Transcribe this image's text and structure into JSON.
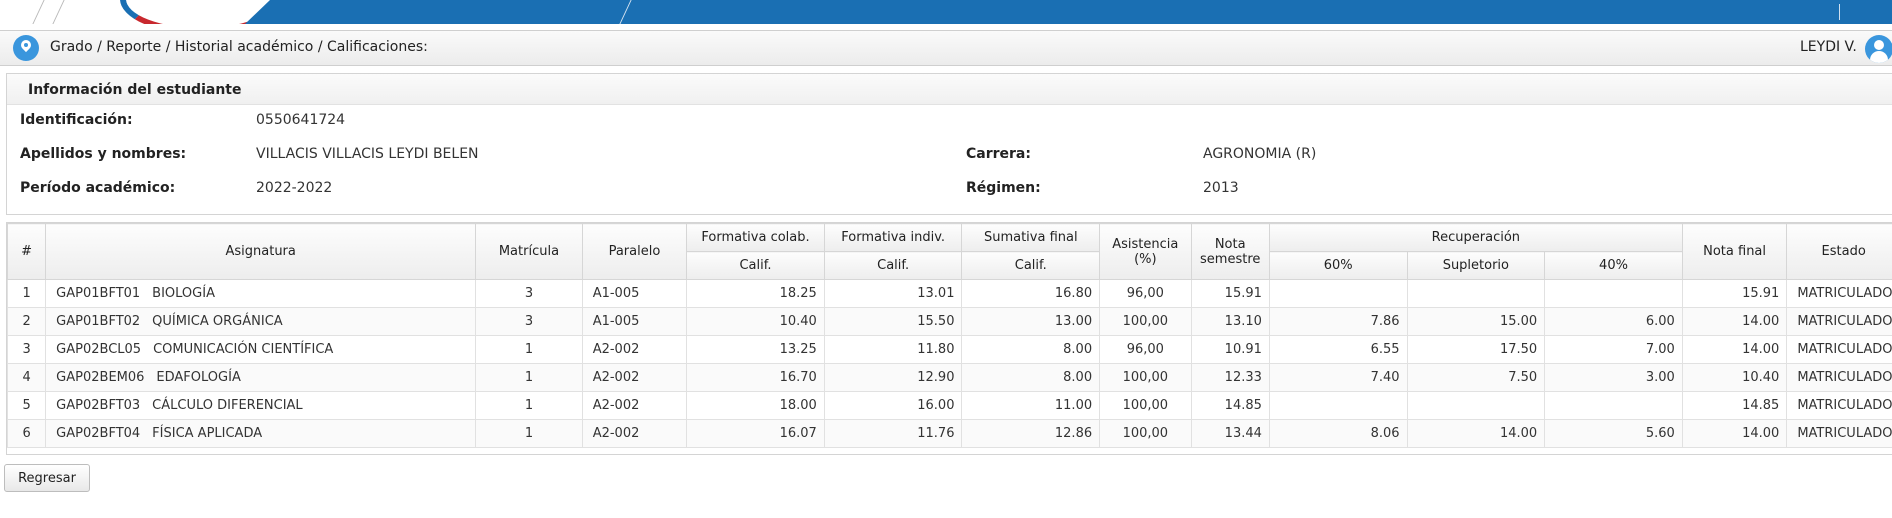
{
  "header": {
    "breadcrumb": "Grado / Reporte / Historial académico / Calificaciones:",
    "user_name": "LEYDI V."
  },
  "student": {
    "panel_title": "Información del estudiante",
    "id_label": "Identificación:",
    "id_value": "0550641724",
    "name_label": "Apellidos y nombres:",
    "name_value": "VILLACIS VILLACIS LEYDI BELEN",
    "period_label": "Período académico:",
    "period_value": "2022-2022",
    "career_label": "Carrera:",
    "career_value": "AGRONOMIA (R)",
    "regime_label": "Régimen:",
    "regime_value": "2013"
  },
  "table": {
    "headers": {
      "num": "#",
      "subject": "Asignatura",
      "enrollment": "Matrícula",
      "parallel": "Paralelo",
      "form_colab": "Formativa colab.",
      "form_indiv": "Formativa indiv.",
      "sum_final": "Sumativa final",
      "attendance": "Asistencia (%)",
      "semester_grade": "Nota semestre",
      "recovery": "Recuperación",
      "final_grade": "Nota final",
      "status": "Estado",
      "calif1": "Calif.",
      "calif2": "Calif.",
      "calif3": "Calif.",
      "rec60": "60%",
      "supletorio": "Supletorio",
      "rec40": "40%"
    },
    "rows": [
      {
        "num": "1",
        "code": "GAP01BFT01",
        "name": "BIOLOGÍA",
        "enrollment": "3",
        "parallel": "A1-005",
        "fc": "18.25",
        "fi": "13.01",
        "sf": "16.80",
        "att": "96,00",
        "sem": "15.91",
        "r60": "",
        "sup": "",
        "r40": "",
        "final": "15.91",
        "status": "MATRICULADO"
      },
      {
        "num": "2",
        "code": "GAP01BFT02",
        "name": "QUÍMICA ORGÁNICA",
        "enrollment": "3",
        "parallel": "A1-005",
        "fc": "10.40",
        "fi": "15.50",
        "sf": "13.00",
        "att": "100,00",
        "sem": "13.10",
        "r60": "7.86",
        "sup": "15.00",
        "r40": "6.00",
        "final": "14.00",
        "status": "MATRICULADO"
      },
      {
        "num": "3",
        "code": "GAP02BCL05",
        "name": "COMUNICACIÓN CIENTÍFICA",
        "enrollment": "1",
        "parallel": "A2-002",
        "fc": "13.25",
        "fi": "11.80",
        "sf": "8.00",
        "att": "96,00",
        "sem": "10.91",
        "r60": "6.55",
        "sup": "17.50",
        "r40": "7.00",
        "final": "14.00",
        "status": "MATRICULADO"
      },
      {
        "num": "4",
        "code": "GAP02BEM06",
        "name": "EDAFOLOGÍA",
        "enrollment": "1",
        "parallel": "A2-002",
        "fc": "16.70",
        "fi": "12.90",
        "sf": "8.00",
        "att": "100,00",
        "sem": "12.33",
        "r60": "7.40",
        "sup": "7.50",
        "r40": "3.00",
        "final": "10.40",
        "status": "MATRICULADO"
      },
      {
        "num": "5",
        "code": "GAP02BFT03",
        "name": "CÁLCULO DIFERENCIAL",
        "enrollment": "1",
        "parallel": "A2-002",
        "fc": "18.00",
        "fi": "16.00",
        "sf": "11.00",
        "att": "100,00",
        "sem": "14.85",
        "r60": "",
        "sup": "",
        "r40": "",
        "final": "14.85",
        "status": "MATRICULADO"
      },
      {
        "num": "6",
        "code": "GAP02BFT04",
        "name": "FÍSICA APLICADA",
        "enrollment": "1",
        "parallel": "A2-002",
        "fc": "16.07",
        "fi": "11.76",
        "sf": "12.86",
        "att": "100,00",
        "sem": "13.44",
        "r60": "8.06",
        "sup": "14.00",
        "r40": "5.60",
        "final": "14.00",
        "status": "MATRICULADO"
      }
    ]
  },
  "actions": {
    "back_label": "Regresar"
  }
}
